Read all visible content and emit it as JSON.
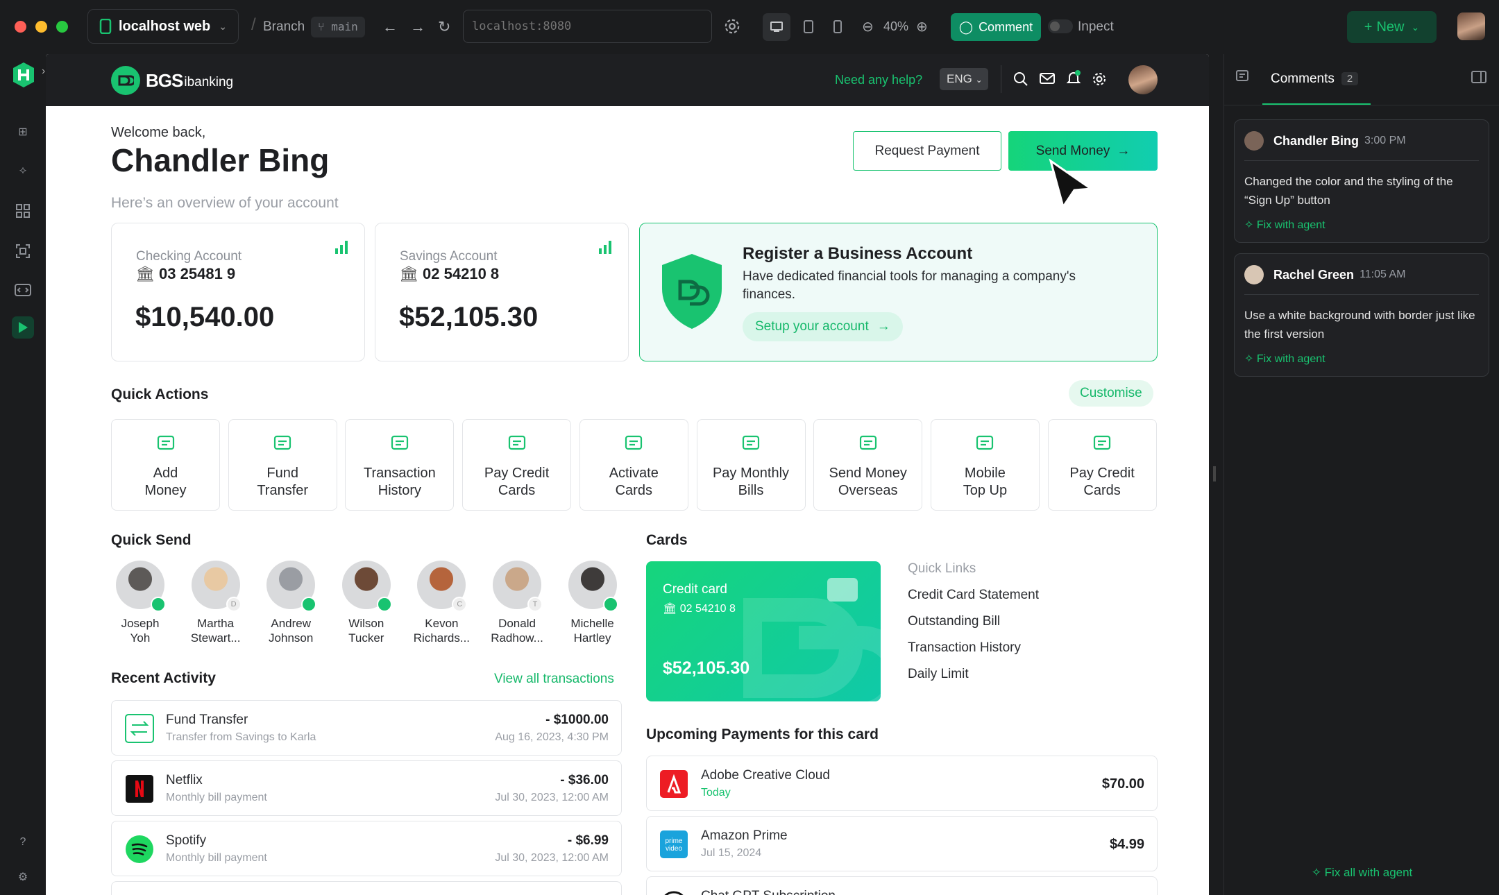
{
  "browser": {
    "project": "localhost web",
    "branch_label": "Branch",
    "branch": "main",
    "url_placeholder": "localhost:8080",
    "zoom": "40%",
    "comment_btn": "Comment",
    "inspect": "Inpect",
    "new_btn": "New"
  },
  "app": {
    "logo_main": "BGS",
    "logo_sub": "ibanking",
    "help": "Need any help?",
    "lang": "ENG",
    "welcome": "Welcome back,",
    "user": "Chandler Bing",
    "overview": "Here’s an overview of your account",
    "request_btn": "Request Payment",
    "send_btn": "Send Money",
    "checking": {
      "label": "Checking Account",
      "number": "03 25481 9",
      "balance": "$10,540.00"
    },
    "savings": {
      "label": "Savings Account",
      "number": "02 54210 8",
      "balance": "$52,105.30"
    },
    "business": {
      "title": "Register a Business Account",
      "desc": "Have dedicated financial tools for managing a company's finances.",
      "cta": "Setup your account"
    },
    "quick_actions_title": "Quick Actions",
    "customise": "Customise",
    "quick_actions": [
      {
        "l1": "Add",
        "l2": "Money"
      },
      {
        "l1": "Fund",
        "l2": "Transfer"
      },
      {
        "l1": "Transaction",
        "l2": "History"
      },
      {
        "l1": "Pay Credit",
        "l2": "Cards"
      },
      {
        "l1": "Activate",
        "l2": "Cards"
      },
      {
        "l1": "Pay Monthly",
        "l2": "Bills"
      },
      {
        "l1": "Send Money",
        "l2": "Overseas"
      },
      {
        "l1": "Mobile",
        "l2": "Top Up"
      },
      {
        "l1": "Pay Credit",
        "l2": "Cards"
      }
    ],
    "quick_send_title": "Quick Send",
    "friends": [
      {
        "l1": "Joseph",
        "l2": "Yoh",
        "b": ""
      },
      {
        "l1": "Martha",
        "l2": "Stewart...",
        "b": "D"
      },
      {
        "l1": "Andrew",
        "l2": "Johnson",
        "b": ""
      },
      {
        "l1": "Wilson",
        "l2": "Tucker",
        "b": ""
      },
      {
        "l1": "Kevon",
        "l2": "Richards...",
        "b": "C"
      },
      {
        "l1": "Donald",
        "l2": "Radhow...",
        "b": "T"
      },
      {
        "l1": "Michelle",
        "l2": "Hartley",
        "b": ""
      }
    ],
    "recent_title": "Recent Activity",
    "view_all": "View all transactions",
    "activity": [
      {
        "name": "Fund Transfer",
        "desc": "Transfer from Savings to Karla",
        "amount": "- $1000.00",
        "date": "Aug 16, 2023, 4:30 PM"
      },
      {
        "name": "Netflix",
        "desc": "Monthly bill payment",
        "amount": "- $36.00",
        "date": "Jul 30, 2023, 12:00 AM"
      },
      {
        "name": "Spotify",
        "desc": "Monthly bill payment",
        "amount": "- $6.99",
        "date": "Jul 30, 2023, 12:00 AM"
      }
    ],
    "cards_title": "Cards",
    "card": {
      "type": "Credit card",
      "number": "02 54210 8",
      "balance": "$52,105.30"
    },
    "quick_links_title": "Quick Links",
    "quick_links": [
      "Credit Card Statement",
      "Outstanding Bill",
      "Transaction History",
      "Daily Limit"
    ],
    "upcoming_title": "Upcoming Payments for this card",
    "payments": [
      {
        "name": "Adobe Creative Cloud",
        "date": "Today",
        "amount": "$70.00"
      },
      {
        "name": "Amazon Prime",
        "date": "Jul 15, 2024",
        "amount": "$4.99"
      },
      {
        "name": "Chat GPT Subscription",
        "date": "",
        "amount": ""
      }
    ]
  },
  "comments": {
    "tab": "Comments",
    "count": "2",
    "fix": "Fix with agent",
    "fix_all": "Fix all with agent",
    "items": [
      {
        "author": "Chandler Bing",
        "time": "3:00 PM",
        "text": "Changed the color and the styling of the “Sign Up” button"
      },
      {
        "author": "Rachel Green",
        "time": "11:05 AM",
        "text": "Use a white background with border just like the first version"
      }
    ]
  },
  "colors": {
    "brand": "#19c370",
    "dark": "#1e1f22",
    "accent_bg": "#effaf8"
  }
}
